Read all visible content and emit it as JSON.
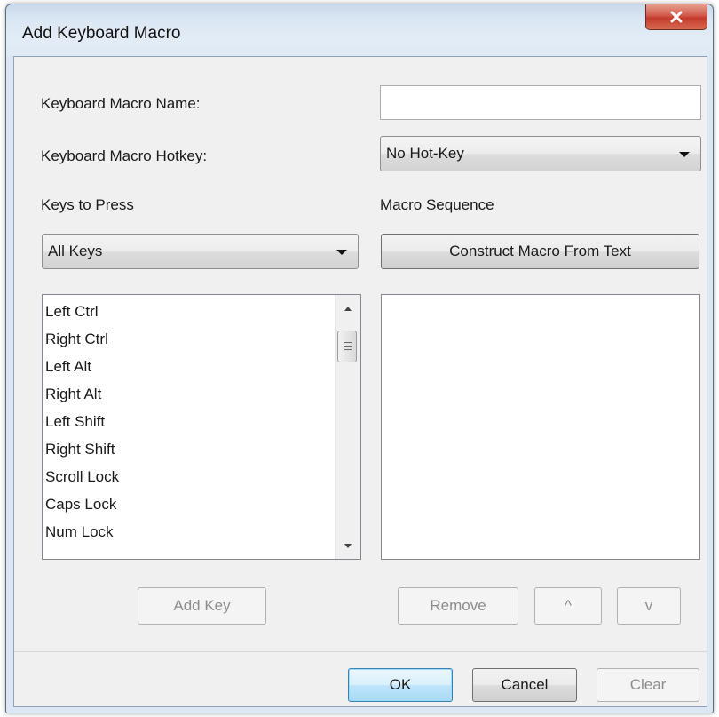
{
  "window": {
    "title": "Add Keyboard Macro",
    "close_glyph": "X"
  },
  "fields": {
    "macro_name_label": "Keyboard Macro Name:",
    "macro_name_value": "",
    "hotkey_label": "Keyboard Macro Hotkey:",
    "hotkey_value": "No Hot-Key"
  },
  "left_panel": {
    "heading": "Keys to Press",
    "filter_value": "All Keys",
    "keys": [
      "Left Ctrl",
      "Right Ctrl",
      "Left Alt",
      "Right Alt",
      "Left Shift",
      "Right Shift",
      "Scroll Lock",
      "Caps Lock",
      "Num Lock"
    ],
    "add_key_label": "Add Key"
  },
  "right_panel": {
    "heading": "Macro Sequence",
    "construct_label": "Construct Macro From Text",
    "sequence": [],
    "remove_label": "Remove",
    "up_label": "^",
    "down_label": "v"
  },
  "footer": {
    "ok_label": "OK",
    "cancel_label": "Cancel",
    "clear_label": "Clear"
  },
  "colors": {
    "close_button": "#c9463a",
    "title_bar": "#dbe7f3",
    "client_bg": "#f0f0f0",
    "default_button": "#bee6fd"
  }
}
